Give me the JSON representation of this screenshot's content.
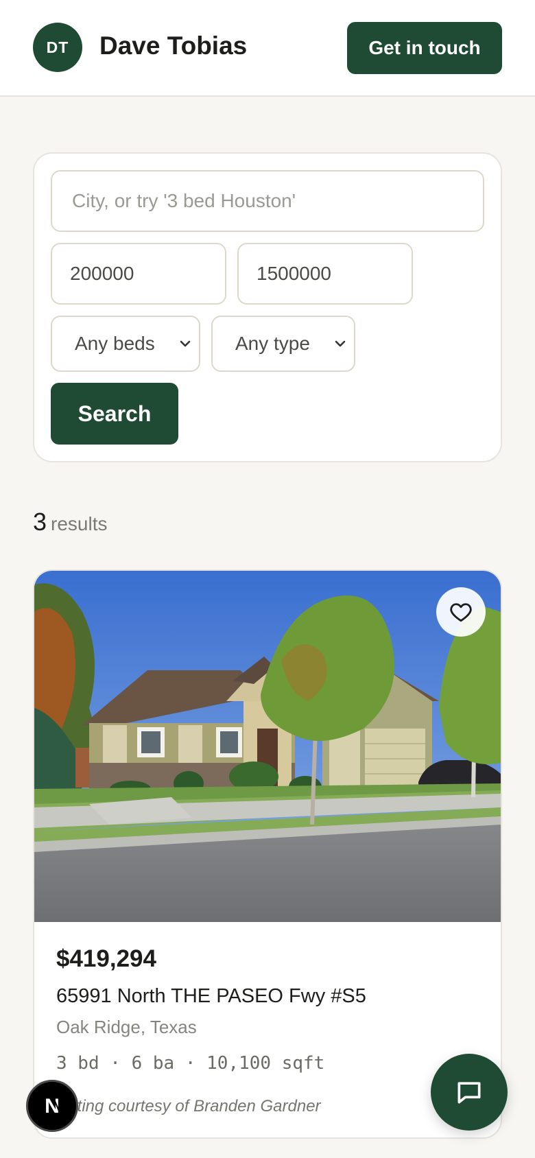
{
  "header": {
    "avatar_initials": "DT",
    "agent_name": "Dave Tobias",
    "cta_label": "Get in touch"
  },
  "search": {
    "query_placeholder": "City, or try '3 bed Houston'",
    "min_price": "200000",
    "max_price": "1500000",
    "beds_selected": "Any beds",
    "type_selected": "Any type",
    "search_label": "Search"
  },
  "results": {
    "count": "3",
    "label": "results"
  },
  "listings": [
    {
      "price": "$419,294",
      "street": "65991 North THE PASEO Fwy #S5",
      "city": "Oak Ridge, Texas",
      "specs": "3 bd · 6 ba · 10,100 sqft",
      "courtesy": "Listing courtesy of Branden Gardner",
      "photo_icon": "house-photo",
      "favorite_icon": "heart-icon"
    }
  ],
  "fab": {
    "icon": "chat-icon"
  },
  "dev_badge": {
    "letter": "N"
  },
  "colors": {
    "brand": "#1f4a33",
    "background": "#f7f6f2",
    "card": "#ffffff",
    "border": "#e6e4dd"
  }
}
